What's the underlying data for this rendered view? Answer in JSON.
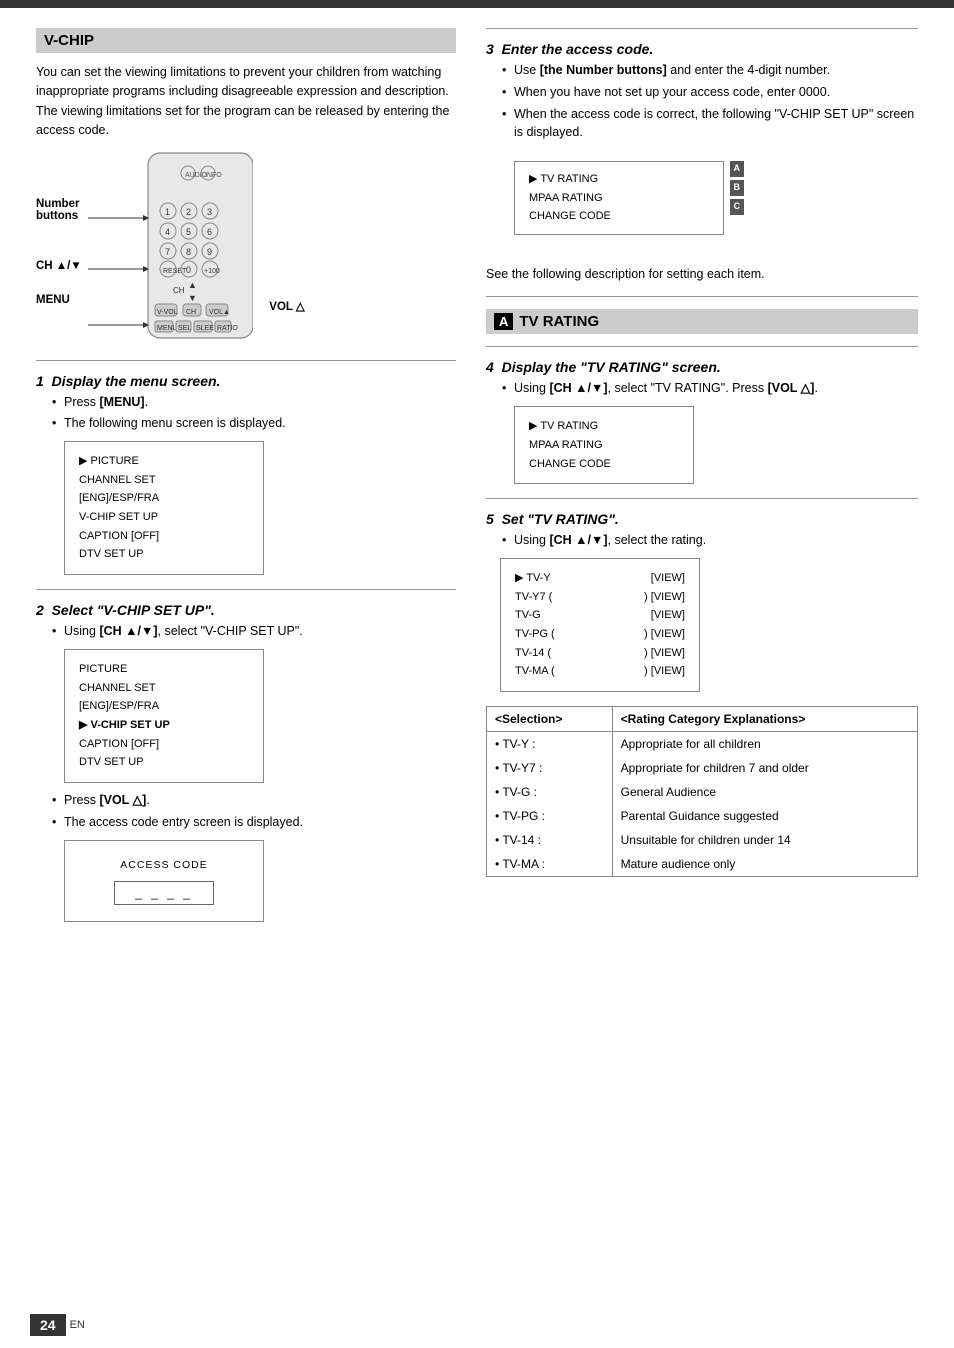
{
  "page": {
    "number": "24",
    "lang": "EN"
  },
  "top_bar": {},
  "left_col": {
    "section_title": "V-CHIP",
    "intro_text": "You can set the viewing limitations to prevent your children from watching inappropriate programs including disagreeable expression and description. The viewing limitations set for the program can be released by entering the access code.",
    "remote_labels": {
      "number_buttons": "Number\nbuttons",
      "ch_label": "CH ▲/▼",
      "menu_label": "MENU",
      "vol_label": "VOL △"
    },
    "step1": {
      "number": "1",
      "text": "Display the menu screen.",
      "bullet1": "Press [MENU].",
      "bullet2": "The following menu screen is displayed."
    },
    "menu1": {
      "items": [
        "▶ PICTURE",
        "CHANNEL SET",
        "[ENG]/ESP/FRA",
        "V-CHIP SET UP",
        "CAPTION [OFF]",
        "DTV SET UP"
      ]
    },
    "step2": {
      "number": "2",
      "text": "Select \"V-CHIP SET UP\".",
      "bullet1": "Using [CH ▲/▼], select \"V-CHIP SET UP\"."
    },
    "menu2": {
      "items": [
        "PICTURE",
        "CHANNEL SET",
        "[ENG]/ESP/FRA",
        "▶ V-CHIP SET UP",
        "CAPTION [OFF]",
        "DTV SET UP"
      ]
    },
    "step2b": {
      "bullet1": "Press [VOL △].",
      "bullet2": "The access code entry screen is displayed."
    },
    "access_code_box": {
      "title": "ACCESS CODE",
      "dashes": "_ _ _ _"
    }
  },
  "right_col": {
    "step3": {
      "number": "3",
      "text": "Enter the access code.",
      "bullets": [
        "Use [the Number buttons] and enter the 4-digit number.",
        "When you have not set up your access code, enter 0000.",
        "When the access code is correct, the following \"V-CHIP SET UP\" screen is displayed."
      ]
    },
    "vchip_screen": {
      "items": [
        "▶ TV RATING",
        "MPAA RATING",
        "CHANGE CODE"
      ],
      "side_labels": [
        "A",
        "B",
        "C"
      ]
    },
    "step3_note": "See the following description for setting each item.",
    "tv_rating_section": {
      "badge": "A",
      "title": "TV RATING"
    },
    "step4": {
      "number": "4",
      "text": "Display the \"TV RATING\" screen.",
      "bullets": [
        "Using [CH ▲/▼], select \"TV RATING\". Press [VOL △]."
      ]
    },
    "tvrating_menu": {
      "items": [
        "▶ TV RATING",
        "MPAA RATING",
        "CHANGE CODE"
      ]
    },
    "step5": {
      "number": "5",
      "text": "Set \"TV RATING\".",
      "bullets": [
        "Using [CH ▲/▼], select the rating."
      ]
    },
    "rating_options": {
      "rows": [
        {
          "label": "▶ TV-Y",
          "value": "[VIEW]"
        },
        {
          "label": "TV-Y7 (",
          "value": ") [VIEW]"
        },
        {
          "label": "TV-G",
          "value": "[VIEW]"
        },
        {
          "label": "TV-PG (",
          "value": ") [VIEW]"
        },
        {
          "label": "TV-14 (",
          "value": ") [VIEW]"
        },
        {
          "label": "TV-MA (",
          "value": ") [VIEW]"
        }
      ]
    },
    "selection_table": {
      "col1_header": "<Selection>",
      "col2_header": "<Rating Category Explanations>",
      "rows": [
        {
          "selection": "• TV-Y :",
          "explanation": "Appropriate for all children"
        },
        {
          "selection": "• TV-Y7 :",
          "explanation": "Appropriate for children 7 and older"
        },
        {
          "selection": "• TV-G :",
          "explanation": "General Audience"
        },
        {
          "selection": "• TV-PG :",
          "explanation": "Parental Guidance suggested"
        },
        {
          "selection": "• TV-14 :",
          "explanation": "Unsuitable for children under 14"
        },
        {
          "selection": "• TV-MA :",
          "explanation": "Mature audience only"
        }
      ]
    }
  }
}
